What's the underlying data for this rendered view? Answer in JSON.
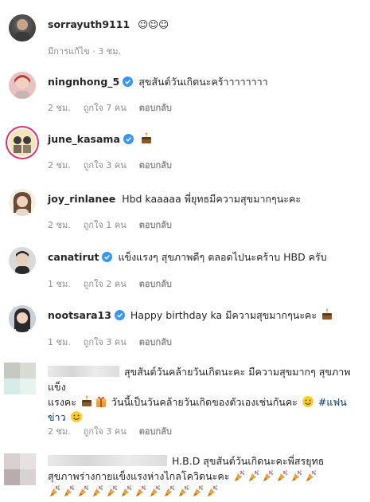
{
  "comments": [
    {
      "user": "sorrayuth9111",
      "verified": false,
      "text": "☺☺☺",
      "meta": "มีการแก้ไข · 3 ชม."
    },
    {
      "user": "ningnhong_5",
      "verified": true,
      "text": "สุขสันต์วันเกิดนะคร้าาาาาาาา",
      "time": "2 ชม.",
      "likes": "ถูกใจ 7 คน",
      "reply": "ตอบกลับ"
    },
    {
      "user": "june_kasama",
      "verified": true,
      "emoji": "cake-icon",
      "time": "2 ชม.",
      "likes": "ถูกใจ 3 คน",
      "reply": "ตอบกลับ"
    },
    {
      "user": "joy_rinlanee",
      "verified": false,
      "text": "Hbd kaaaaa พี่ยุทธมีความสุขมากๆนะคะ",
      "time": "2 ชม.",
      "likes": "ถูกใจ 1 คน",
      "reply": "ตอบกลับ"
    },
    {
      "user": "canatirut",
      "verified": true,
      "text": "แข็งแรงๆ สุขภาพดีๆ ตลอดไปนะคร้าบ HBD ครับ",
      "time": "1 ชม.",
      "likes": "ถูกใจ 2 คน",
      "reply": "ตอบกลับ"
    },
    {
      "user": "nootsara13",
      "verified": true,
      "text": "Happy birthday ka มีความสุขมากๆนะคะ",
      "emoji": "cake-icon",
      "time": "1 ชม.",
      "likes": "ถูกใจ 3 คน",
      "reply": "ตอบกลับ"
    },
    {
      "user": "",
      "line1": "สุขสันต์วันคล้ายวันเกิดนะคะ มีความสุขมากๆ สุขภาพแข็ง",
      "line2a": "แรงคะ",
      "line2b": "วันนี้เป็นวันคล้ายวันเกิดของตัวเองเช่นกันคะ",
      "hashtag": "#แฟน",
      "line3": "ข่าว",
      "time": "2 ชม.",
      "likes": "ถูกใจ 3 คน",
      "reply": "ตอบกลับ"
    },
    {
      "user": "",
      "line1": "H.B.D สุขสันต์วันเกิดนะคะพี่สรยุทธ",
      "line2": "สุขภาพร่างกายแข็งแรงห่างไกลโควิดนะคะ",
      "emoji": "party-popper-icon"
    }
  ],
  "colors": {
    "verified": "#3897f0",
    "meta": "#8e8e8e",
    "hashtag": "#00376b"
  }
}
